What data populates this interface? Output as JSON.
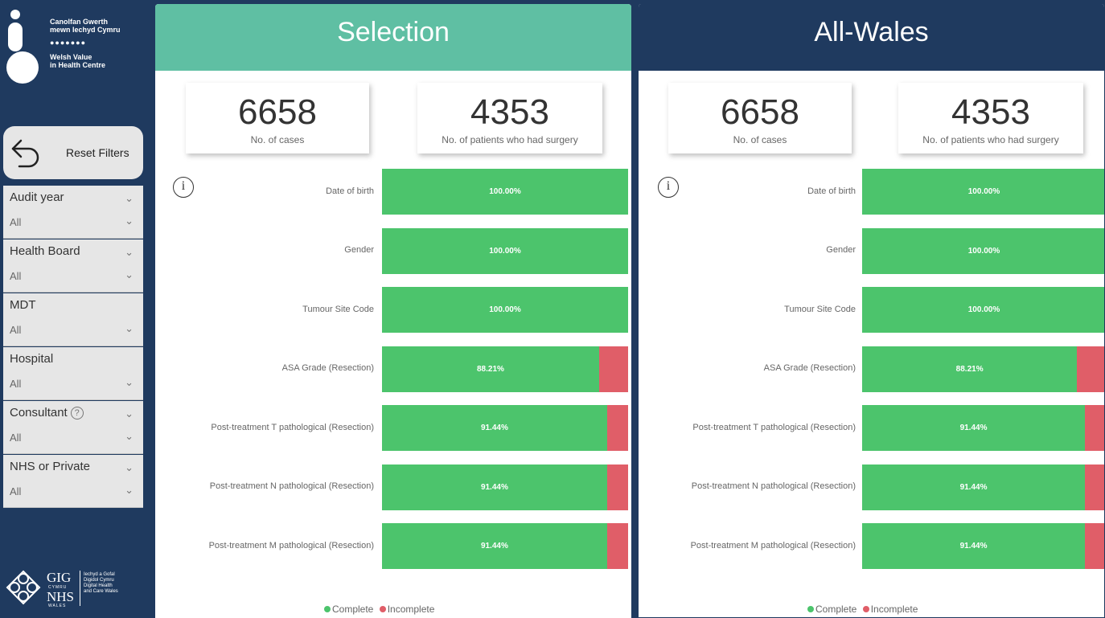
{
  "sidebar": {
    "logo": {
      "welsh_name": "Canolfan Gwerth\nmewn Iechyd Cymru",
      "dots": "●●●●●●●",
      "english_name": "Welsh Value\nin Health Centre"
    },
    "reset_label": "Reset Filters",
    "filters": [
      {
        "title": "Audit year",
        "value": "All"
      },
      {
        "title": "Health Board",
        "value": "All"
      },
      {
        "title": "MDT",
        "value": "All"
      },
      {
        "title": "Hospital",
        "value": "All"
      },
      {
        "title": "Consultant",
        "value": "All",
        "help": "?"
      },
      {
        "title": "NHS or Private",
        "value": "All"
      }
    ],
    "footer": {
      "gig": "GIG",
      "cymru": "CYMRU",
      "nhs": "NHS",
      "wales": "WALES",
      "dhcw": "Iechyd a Gofal\nDigidol Cymru\nDigital Health\nand Care Wales"
    }
  },
  "panels": {
    "selection": {
      "title": "Selection",
      "kpis": [
        {
          "value": "6658",
          "caption": "No. of cases"
        },
        {
          "value": "4353",
          "caption": "No. of patients who had surgery"
        }
      ],
      "info_icon": "i"
    },
    "wales": {
      "title": "All-Wales",
      "kpis": [
        {
          "value": "6658",
          "caption": "No. of cases"
        },
        {
          "value": "4353",
          "caption": "No. of patients who had surgery"
        }
      ],
      "info_icon": "i"
    }
  },
  "legend": {
    "complete": "Complete",
    "incomplete": "Incomplete"
  },
  "colors": {
    "complete": "#4cc46c",
    "incomplete": "#e05e68",
    "selection_header": "#5fbfa3",
    "wales_header": "#1f3a5f"
  },
  "chart_data": [
    {
      "type": "bar",
      "orientation": "horizontal",
      "stacked": true,
      "title": "Selection",
      "categories": [
        "Date of birth",
        "Gender",
        "Tumour Site Code",
        "ASA Grade (Resection)",
        "Post-treatment T pathological (Resection)",
        "Post-treatment N pathological (Resection)",
        "Post-treatment M pathological (Resection)"
      ],
      "series": [
        {
          "name": "Complete",
          "values": [
            100.0,
            100.0,
            100.0,
            88.21,
            91.44,
            91.44,
            91.44
          ],
          "labels": [
            "100.00%",
            "100.00%",
            "100.00%",
            "88.21%",
            "91.44%",
            "91.44%",
            "91.44%"
          ]
        },
        {
          "name": "Incomplete",
          "values": [
            0.0,
            0.0,
            0.0,
            11.79,
            8.56,
            8.56,
            8.56
          ]
        }
      ],
      "xlim": [
        0,
        100
      ],
      "legend": "bottom"
    },
    {
      "type": "bar",
      "orientation": "horizontal",
      "stacked": true,
      "title": "All-Wales",
      "categories": [
        "Date of birth",
        "Gender",
        "Tumour Site Code",
        "ASA Grade (Resection)",
        "Post-treatment T pathological (Resection)",
        "Post-treatment N pathological (Resection)",
        "Post-treatment M pathological (Resection)"
      ],
      "series": [
        {
          "name": "Complete",
          "values": [
            100.0,
            100.0,
            100.0,
            88.21,
            91.44,
            91.44,
            91.44
          ],
          "labels": [
            "100.00%",
            "100.00%",
            "100.00%",
            "88.21%",
            "91.44%",
            "91.44%",
            "91.44%"
          ]
        },
        {
          "name": "Incomplete",
          "values": [
            0.0,
            0.0,
            0.0,
            11.79,
            8.56,
            8.56,
            8.56
          ]
        }
      ],
      "xlim": [
        0,
        100
      ],
      "legend": "bottom"
    }
  ]
}
